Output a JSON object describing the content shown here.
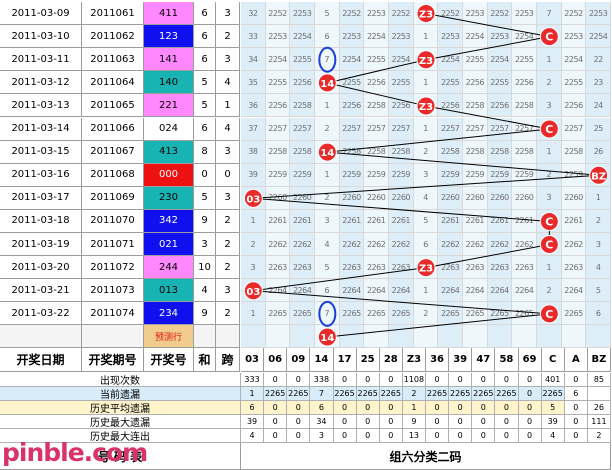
{
  "accent": {
    "orange": "#ff6e10",
    "predict": "#f0cc8e",
    "purple": "#ff88ff",
    "blue": "#1010ee",
    "teal": "#18b4b4",
    "red": "#ee1111",
    "circle": "#e82a2a",
    "grid_a": "#ddeef9",
    "grid_b": "#eef7fc"
  },
  "draws": [
    {
      "date": "2011-03-09",
      "issue": "2011061",
      "number": "411",
      "sum": "6",
      "span": "3",
      "style": "purple",
      "grid": [
        "32",
        "2252",
        "2253",
        "5",
        "2252",
        "2253",
        "2252",
        "Z3",
        "2252",
        "2253",
        "2252",
        "2253",
        "7",
        "2252",
        "2253"
      ]
    },
    {
      "date": "2011-03-10",
      "issue": "2011062",
      "number": "123",
      "sum": "6",
      "span": "2",
      "style": "blue",
      "grid": [
        "33",
        "2253",
        "2254",
        "6",
        "2253",
        "2254",
        "2253",
        "1",
        "2253",
        "2254",
        "2253",
        "2254",
        "C",
        "2253",
        "2254"
      ]
    },
    {
      "date": "2011-03-11",
      "issue": "2011063",
      "number": "141",
      "sum": "6",
      "span": "3",
      "style": "purple",
      "grid": [
        "34",
        "2254",
        "2255",
        "7",
        "2254",
        "2255",
        "2254",
        "Z3",
        "2254",
        "2255",
        "2254",
        "2255",
        "1",
        "2254",
        "22"
      ]
    },
    {
      "date": "2011-03-12",
      "issue": "2011064",
      "number": "140",
      "sum": "5",
      "span": "4",
      "style": "teal",
      "grid": [
        "35",
        "2255",
        "2256",
        "14",
        "2255",
        "2256",
        "2255",
        "1",
        "2255",
        "2256",
        "2255",
        "2256",
        "2",
        "2255",
        "23"
      ]
    },
    {
      "date": "2011-03-13",
      "issue": "2011065",
      "number": "221",
      "sum": "5",
      "span": "1",
      "style": "purple",
      "grid": [
        "36",
        "2256",
        "2258",
        "1",
        "2256",
        "2258",
        "2256",
        "Z3",
        "2256",
        "2258",
        "2256",
        "2258",
        "3",
        "2256",
        "24"
      ]
    },
    {
      "date": "2011-03-14",
      "issue": "2011066",
      "number": "024",
      "sum": "6",
      "span": "4",
      "style": "white",
      "grid": [
        "37",
        "2257",
        "2257",
        "2",
        "2257",
        "2257",
        "2257",
        "1",
        "2257",
        "2257",
        "2257",
        "2257",
        "C",
        "2257",
        "25"
      ]
    },
    {
      "date": "2011-03-15",
      "issue": "2011067",
      "number": "413",
      "sum": "8",
      "span": "3",
      "style": "teal",
      "grid": [
        "38",
        "2258",
        "2258",
        "14",
        "2258",
        "2258",
        "2258",
        "2",
        "2258",
        "2258",
        "2258",
        "2258",
        "1",
        "2258",
        "26"
      ]
    },
    {
      "date": "2011-03-16",
      "issue": "2011068",
      "number": "000",
      "sum": "0",
      "span": "0",
      "style": "red",
      "grid": [
        "39",
        "2259",
        "2259",
        "1",
        "2259",
        "2259",
        "2259",
        "3",
        "2259",
        "2259",
        "2259",
        "2259",
        "2",
        "2259",
        "BZ"
      ]
    },
    {
      "date": "2011-03-17",
      "issue": "2011069",
      "number": "230",
      "sum": "5",
      "span": "3",
      "style": "teal",
      "grid": [
        "03",
        "2260",
        "2260",
        "2",
        "2260",
        "2260",
        "2260",
        "4",
        "2260",
        "2260",
        "2260",
        "2260",
        "3",
        "2260",
        "1"
      ]
    },
    {
      "date": "2011-03-18",
      "issue": "2011070",
      "number": "342",
      "sum": "9",
      "span": "2",
      "style": "blue",
      "grid": [
        "1",
        "2261",
        "2261",
        "3",
        "2261",
        "2261",
        "2261",
        "5",
        "2261",
        "2261",
        "2261",
        "2261",
        "C",
        "2261",
        "2"
      ]
    },
    {
      "date": "2011-03-19",
      "issue": "2011071",
      "number": "021",
      "sum": "3",
      "span": "2",
      "style": "blue",
      "grid": [
        "2",
        "2262",
        "2262",
        "4",
        "2262",
        "2262",
        "2262",
        "6",
        "2262",
        "2262",
        "2262",
        "2262",
        "C",
        "2262",
        "3"
      ]
    },
    {
      "date": "2011-03-20",
      "issue": "2011072",
      "number": "244",
      "sum": "10",
      "span": "2",
      "style": "purple",
      "grid": [
        "3",
        "2263",
        "2263",
        "5",
        "2263",
        "2263",
        "2263",
        "Z3",
        "2263",
        "2263",
        "2263",
        "2263",
        "1",
        "2263",
        "4"
      ]
    },
    {
      "date": "2011-03-21",
      "issue": "2011073",
      "number": "013",
      "sum": "4",
      "span": "3",
      "style": "teal",
      "grid": [
        "03",
        "2264",
        "2264",
        "6",
        "2264",
        "2264",
        "2264",
        "1",
        "2264",
        "2264",
        "2264",
        "2264",
        "2",
        "2264",
        "5"
      ]
    },
    {
      "date": "2011-03-22",
      "issue": "2011074",
      "number": "234",
      "sum": "9",
      "span": "2",
      "style": "blue",
      "grid": [
        "1",
        "2265",
        "2265",
        "7",
        "2265",
        "2265",
        "2265",
        "2",
        "2265",
        "2265",
        "2265",
        "2265",
        "C",
        "2265",
        "6"
      ]
    }
  ],
  "predict_label": "预测行",
  "predict_row": [
    "",
    "",
    "",
    "14",
    "",
    "",
    "",
    "",
    "",
    "",
    "",
    "",
    "",
    "",
    ""
  ],
  "headers": {
    "date": "开奖日期",
    "issue": "开奖期号",
    "number": "开奖号",
    "sum": "和",
    "span": "跨"
  },
  "columns": [
    "03",
    "06",
    "09",
    "14",
    "17",
    "25",
    "28",
    "Z3",
    "36",
    "39",
    "47",
    "58",
    "69",
    "C",
    "A",
    "BZ"
  ],
  "stats": [
    {
      "label": "出现次数",
      "bg": "#ffffff",
      "color": "#000000",
      "values": [
        "333",
        "0",
        "0",
        "338",
        "0",
        "0",
        "0",
        "1108",
        "0",
        "0",
        "0",
        "0",
        "0",
        "401",
        "0",
        "85"
      ]
    },
    {
      "label": "当前遗漏",
      "bg": "#d8ecfa",
      "color": "#000000",
      "values": [
        "1",
        "2265",
        "2265",
        "7",
        "2265",
        "2265",
        "2265",
        "2",
        "2265",
        "2265",
        "2265",
        "2265",
        "0",
        "2265",
        "6",
        ""
      ]
    },
    {
      "label": "历史平均遗漏",
      "bg": "#fff4cc",
      "color": "#000000",
      "values": [
        "6",
        "0",
        "0",
        "6",
        "0",
        "0",
        "0",
        "1",
        "0",
        "0",
        "0",
        "0",
        "0",
        "5",
        "0",
        "26"
      ]
    },
    {
      "label": "历史最大遗漏",
      "bg": "#ffffff",
      "color": "#000000",
      "values": [
        "39",
        "0",
        "0",
        "34",
        "0",
        "0",
        "0",
        "9",
        "0",
        "0",
        "0",
        "0",
        "0",
        "39",
        "0",
        "111"
      ]
    },
    {
      "label": "历史最大连出",
      "bg": "#ffffff",
      "color": "#000000",
      "values": [
        "4",
        "0",
        "0",
        "3",
        "0",
        "0",
        "0",
        "13",
        "0",
        "0",
        "0",
        "0",
        "0",
        "4",
        "0",
        "2"
      ]
    }
  ],
  "footer_left": "号    码    表",
  "footer_right": "组六分类二码",
  "watermark": "pinble.com"
}
